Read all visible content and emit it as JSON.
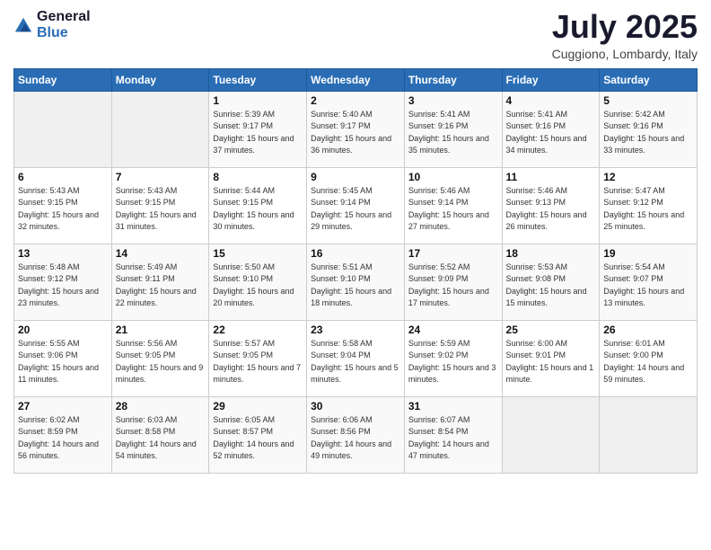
{
  "logo": {
    "line1": "General",
    "line2": "Blue"
  },
  "header": {
    "month_title": "July 2025",
    "location": "Cuggiono, Lombardy, Italy"
  },
  "weekdays": [
    "Sunday",
    "Monday",
    "Tuesday",
    "Wednesday",
    "Thursday",
    "Friday",
    "Saturday"
  ],
  "weeks": [
    [
      {
        "day": "",
        "sunrise": "",
        "sunset": "",
        "daylight": ""
      },
      {
        "day": "",
        "sunrise": "",
        "sunset": "",
        "daylight": ""
      },
      {
        "day": "1",
        "sunrise": "Sunrise: 5:39 AM",
        "sunset": "Sunset: 9:17 PM",
        "daylight": "Daylight: 15 hours and 37 minutes."
      },
      {
        "day": "2",
        "sunrise": "Sunrise: 5:40 AM",
        "sunset": "Sunset: 9:17 PM",
        "daylight": "Daylight: 15 hours and 36 minutes."
      },
      {
        "day": "3",
        "sunrise": "Sunrise: 5:41 AM",
        "sunset": "Sunset: 9:16 PM",
        "daylight": "Daylight: 15 hours and 35 minutes."
      },
      {
        "day": "4",
        "sunrise": "Sunrise: 5:41 AM",
        "sunset": "Sunset: 9:16 PM",
        "daylight": "Daylight: 15 hours and 34 minutes."
      },
      {
        "day": "5",
        "sunrise": "Sunrise: 5:42 AM",
        "sunset": "Sunset: 9:16 PM",
        "daylight": "Daylight: 15 hours and 33 minutes."
      }
    ],
    [
      {
        "day": "6",
        "sunrise": "Sunrise: 5:43 AM",
        "sunset": "Sunset: 9:15 PM",
        "daylight": "Daylight: 15 hours and 32 minutes."
      },
      {
        "day": "7",
        "sunrise": "Sunrise: 5:43 AM",
        "sunset": "Sunset: 9:15 PM",
        "daylight": "Daylight: 15 hours and 31 minutes."
      },
      {
        "day": "8",
        "sunrise": "Sunrise: 5:44 AM",
        "sunset": "Sunset: 9:15 PM",
        "daylight": "Daylight: 15 hours and 30 minutes."
      },
      {
        "day": "9",
        "sunrise": "Sunrise: 5:45 AM",
        "sunset": "Sunset: 9:14 PM",
        "daylight": "Daylight: 15 hours and 29 minutes."
      },
      {
        "day": "10",
        "sunrise": "Sunrise: 5:46 AM",
        "sunset": "Sunset: 9:14 PM",
        "daylight": "Daylight: 15 hours and 27 minutes."
      },
      {
        "day": "11",
        "sunrise": "Sunrise: 5:46 AM",
        "sunset": "Sunset: 9:13 PM",
        "daylight": "Daylight: 15 hours and 26 minutes."
      },
      {
        "day": "12",
        "sunrise": "Sunrise: 5:47 AM",
        "sunset": "Sunset: 9:12 PM",
        "daylight": "Daylight: 15 hours and 25 minutes."
      }
    ],
    [
      {
        "day": "13",
        "sunrise": "Sunrise: 5:48 AM",
        "sunset": "Sunset: 9:12 PM",
        "daylight": "Daylight: 15 hours and 23 minutes."
      },
      {
        "day": "14",
        "sunrise": "Sunrise: 5:49 AM",
        "sunset": "Sunset: 9:11 PM",
        "daylight": "Daylight: 15 hours and 22 minutes."
      },
      {
        "day": "15",
        "sunrise": "Sunrise: 5:50 AM",
        "sunset": "Sunset: 9:10 PM",
        "daylight": "Daylight: 15 hours and 20 minutes."
      },
      {
        "day": "16",
        "sunrise": "Sunrise: 5:51 AM",
        "sunset": "Sunset: 9:10 PM",
        "daylight": "Daylight: 15 hours and 18 minutes."
      },
      {
        "day": "17",
        "sunrise": "Sunrise: 5:52 AM",
        "sunset": "Sunset: 9:09 PM",
        "daylight": "Daylight: 15 hours and 17 minutes."
      },
      {
        "day": "18",
        "sunrise": "Sunrise: 5:53 AM",
        "sunset": "Sunset: 9:08 PM",
        "daylight": "Daylight: 15 hours and 15 minutes."
      },
      {
        "day": "19",
        "sunrise": "Sunrise: 5:54 AM",
        "sunset": "Sunset: 9:07 PM",
        "daylight": "Daylight: 15 hours and 13 minutes."
      }
    ],
    [
      {
        "day": "20",
        "sunrise": "Sunrise: 5:55 AM",
        "sunset": "Sunset: 9:06 PM",
        "daylight": "Daylight: 15 hours and 11 minutes."
      },
      {
        "day": "21",
        "sunrise": "Sunrise: 5:56 AM",
        "sunset": "Sunset: 9:05 PM",
        "daylight": "Daylight: 15 hours and 9 minutes."
      },
      {
        "day": "22",
        "sunrise": "Sunrise: 5:57 AM",
        "sunset": "Sunset: 9:05 PM",
        "daylight": "Daylight: 15 hours and 7 minutes."
      },
      {
        "day": "23",
        "sunrise": "Sunrise: 5:58 AM",
        "sunset": "Sunset: 9:04 PM",
        "daylight": "Daylight: 15 hours and 5 minutes."
      },
      {
        "day": "24",
        "sunrise": "Sunrise: 5:59 AM",
        "sunset": "Sunset: 9:02 PM",
        "daylight": "Daylight: 15 hours and 3 minutes."
      },
      {
        "day": "25",
        "sunrise": "Sunrise: 6:00 AM",
        "sunset": "Sunset: 9:01 PM",
        "daylight": "Daylight: 15 hours and 1 minute."
      },
      {
        "day": "26",
        "sunrise": "Sunrise: 6:01 AM",
        "sunset": "Sunset: 9:00 PM",
        "daylight": "Daylight: 14 hours and 59 minutes."
      }
    ],
    [
      {
        "day": "27",
        "sunrise": "Sunrise: 6:02 AM",
        "sunset": "Sunset: 8:59 PM",
        "daylight": "Daylight: 14 hours and 56 minutes."
      },
      {
        "day": "28",
        "sunrise": "Sunrise: 6:03 AM",
        "sunset": "Sunset: 8:58 PM",
        "daylight": "Daylight: 14 hours and 54 minutes."
      },
      {
        "day": "29",
        "sunrise": "Sunrise: 6:05 AM",
        "sunset": "Sunset: 8:57 PM",
        "daylight": "Daylight: 14 hours and 52 minutes."
      },
      {
        "day": "30",
        "sunrise": "Sunrise: 6:06 AM",
        "sunset": "Sunset: 8:56 PM",
        "daylight": "Daylight: 14 hours and 49 minutes."
      },
      {
        "day": "31",
        "sunrise": "Sunrise: 6:07 AM",
        "sunset": "Sunset: 8:54 PM",
        "daylight": "Daylight: 14 hours and 47 minutes."
      },
      {
        "day": "",
        "sunrise": "",
        "sunset": "",
        "daylight": ""
      },
      {
        "day": "",
        "sunrise": "",
        "sunset": "",
        "daylight": ""
      }
    ]
  ]
}
